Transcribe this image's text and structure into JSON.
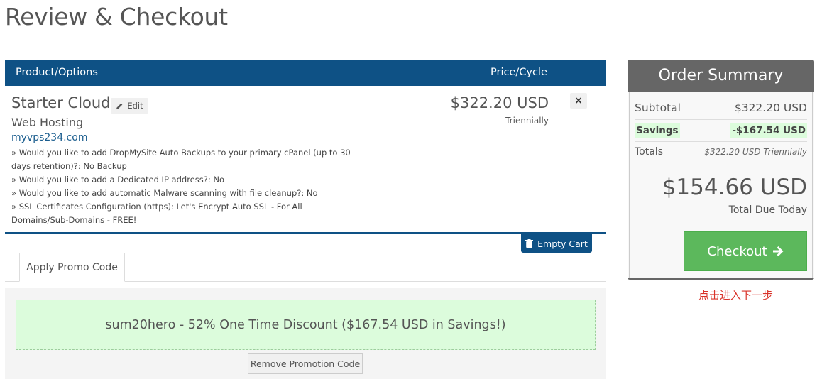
{
  "page": {
    "title": "Review & Checkout"
  },
  "table": {
    "col_product": "Product/Options",
    "col_price": "Price/Cycle"
  },
  "item": {
    "name": "Starter Cloud",
    "edit_label": "Edit",
    "group": "Web Hosting",
    "domain": "myvps234.com",
    "options": [
      "» Would you like to add DropMySite Auto Backups to your primary cPanel (up to 30 days retention)?: No Backup",
      "» Would you like to add a Dedicated IP address?: No",
      "» Would you like to add automatic Malware scanning with file cleanup?: No",
      "» SSL Certificates Configuration (https): Let's Encrypt Auto SSL - For All Domains/Sub-Domains - FREE!"
    ],
    "price": "$322.20 USD",
    "cycle": "Triennially",
    "remove_icon": "close-icon"
  },
  "cart": {
    "empty_label": "Empty Cart"
  },
  "promo": {
    "tab_label": "Apply Promo Code",
    "applied_text": "sum20hero - 52% One Time Discount ($167.54 USD in Savings!)",
    "remove_label": "Remove Promotion Code"
  },
  "summary": {
    "title": "Order Summary",
    "subtotal_label": "Subtotal",
    "subtotal_value": "$322.20 USD",
    "savings_label": "Savings",
    "savings_value": "-$167.54 USD",
    "totals_label": "Totals",
    "totals_value": "$322.20 USD Triennially",
    "total_due": "$154.66 USD",
    "total_due_label": "Total Due Today",
    "checkout_label": "Checkout",
    "note": "点击进入下一步"
  },
  "colors": {
    "header_blue": "#0e5185",
    "checkout_green": "#5cb85c",
    "savings_bg": "#dcfcdc",
    "note_red": "#d9332a"
  }
}
